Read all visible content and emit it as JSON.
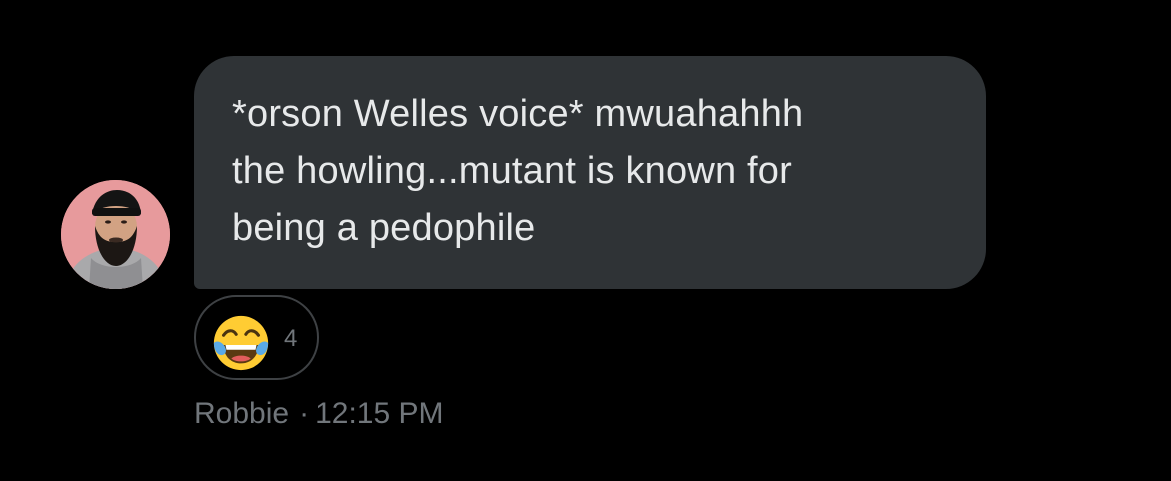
{
  "message": {
    "text": "*orson Welles voice* mwuahahhh\nthe howling...mutant is known for\nbeing a pedophile",
    "bubble_color": "#2f3336",
    "text_color": "#e7e9ea"
  },
  "reaction": {
    "emoji_icon": "face-with-tears-of-joy-icon",
    "count": "4"
  },
  "meta": {
    "sender": "Robbie",
    "separator": "·",
    "time": "12:15 PM",
    "color": "#71767b"
  },
  "avatar": {
    "background": "#e79a9c"
  }
}
